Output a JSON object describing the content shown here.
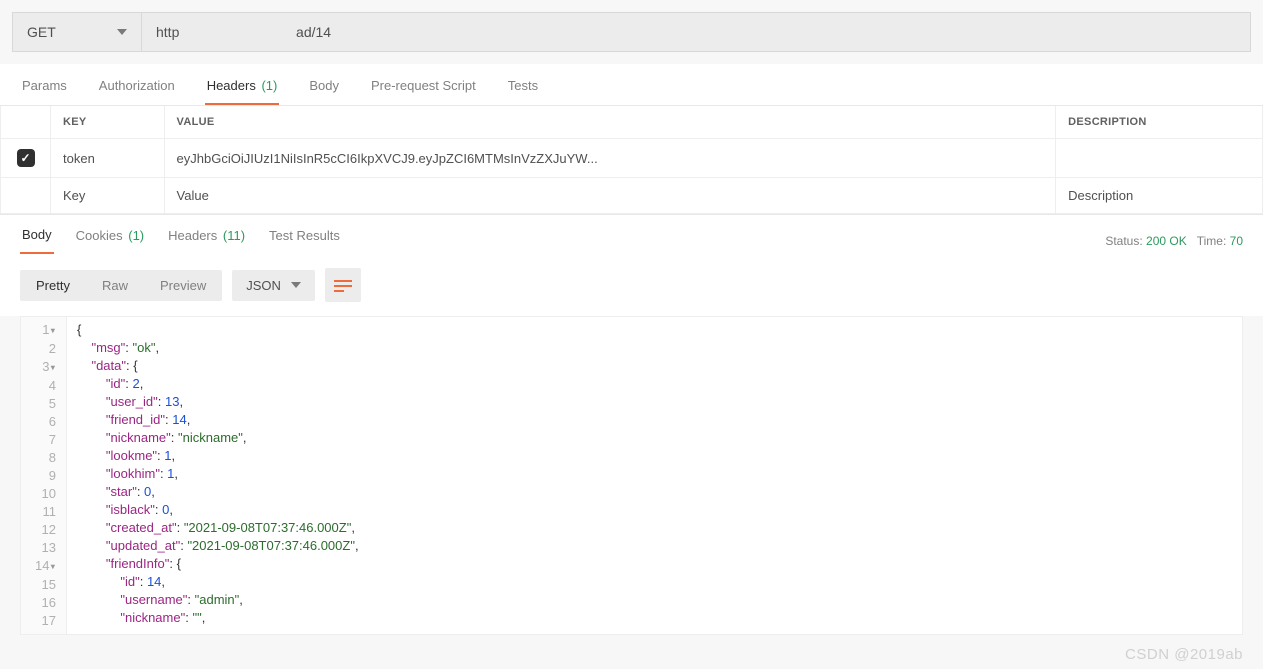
{
  "request": {
    "method": "GET",
    "url_prefix": "http",
    "url_suffix": "ad/14"
  },
  "req_tabs": {
    "params": "Params",
    "authorization": "Authorization",
    "headers_label": "Headers",
    "headers_count": "(1)",
    "body": "Body",
    "prerequest": "Pre-request Script",
    "tests": "Tests"
  },
  "headers_table": {
    "col_key": "KEY",
    "col_value": "VALUE",
    "col_desc": "DESCRIPTION",
    "rows": [
      {
        "checked": true,
        "key": "token",
        "value": "eyJhbGciOiJIUzI1NiIsInR5cCI6IkpXVCJ9.eyJpZCI6MTMsInVzZXJuYW...",
        "desc": ""
      }
    ],
    "placeholder_key": "Key",
    "placeholder_value": "Value",
    "placeholder_desc": "Description"
  },
  "resp_tabs": {
    "body": "Body",
    "cookies_label": "Cookies",
    "cookies_count": "(1)",
    "headers_label": "Headers",
    "headers_count": "(11)",
    "test_results": "Test Results"
  },
  "status": {
    "label": "Status:",
    "value": "200 OK",
    "time_label": "Time:",
    "time_value": "70"
  },
  "viewer": {
    "pretty": "Pretty",
    "raw": "Raw",
    "preview": "Preview",
    "lang": "JSON"
  },
  "json_body": {
    "msg": "ok",
    "data": {
      "id": 2,
      "user_id": 13,
      "friend_id": 14,
      "nickname": "nickname",
      "lookme": 1,
      "lookhim": 1,
      "star": 0,
      "isblack": 0,
      "created_at": "2021-09-08T07:37:46.000Z",
      "updated_at": "2021-09-08T07:37:46.000Z",
      "friendInfo": {
        "id": 14,
        "username": "admin",
        "nickname": ""
      }
    }
  },
  "watermark": "CSDN @2019ab"
}
